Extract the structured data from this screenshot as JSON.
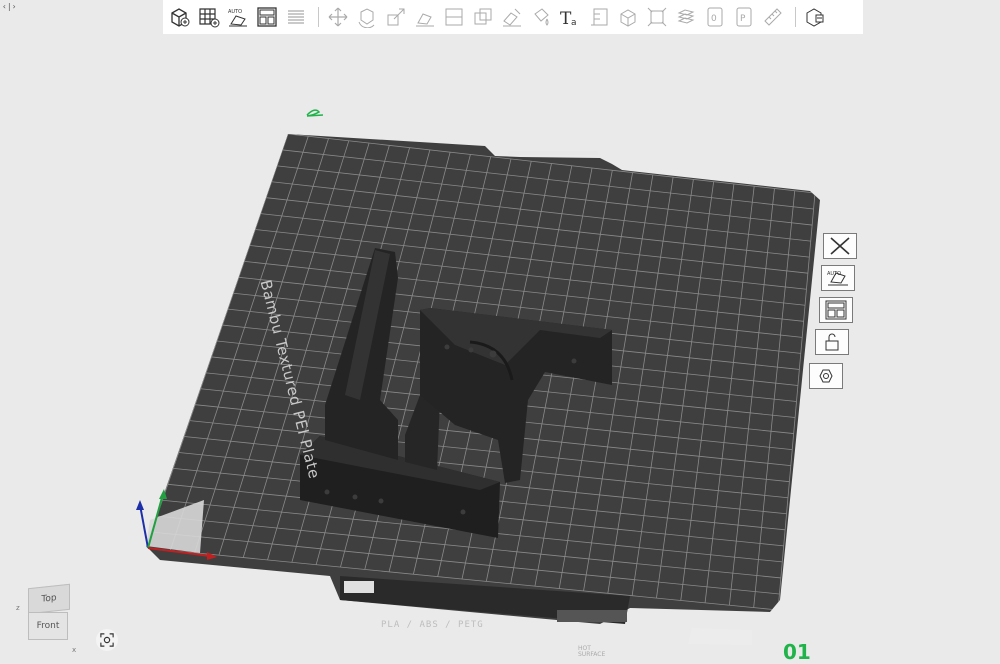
{
  "corner_toggle": "‹|›",
  "toolbar": {
    "items": [
      "add-object-icon",
      "add-plate-icon",
      "auto-orient-icon",
      "arrange-icon",
      "layers-icon",
      "move-icon",
      "rotate-icon",
      "scale-icon",
      "lay-on-face-icon",
      "cut-icon",
      "boolean-icon",
      "support-paint-icon",
      "seam-paint-icon",
      "text-icon",
      "variable-layer-icon",
      "assembly-icon",
      "measure-icon",
      "slice-layers-icon",
      "preview-icon",
      "publish-icon",
      "ruler-icon",
      "cube-split-icon"
    ]
  },
  "side_tools": [
    "close-plate-icon",
    "auto-orient-icon",
    "arrange-plate-icon",
    "lock-plate-icon",
    "plate-settings-icon"
  ],
  "plate": {
    "label": "Bambu Textured PEI Plate",
    "number": "01",
    "filament": "PLA / ABS / PETG",
    "surface": "HOT SURFACE"
  },
  "view_cube": {
    "top": "Top",
    "front": "Front",
    "z": "z",
    "x": "x",
    "y": "y"
  },
  "colors": {
    "bed": "#3f3f3f",
    "grid": "#8a8a8a",
    "model": "#262626",
    "plate_number": "#1fb34a"
  }
}
